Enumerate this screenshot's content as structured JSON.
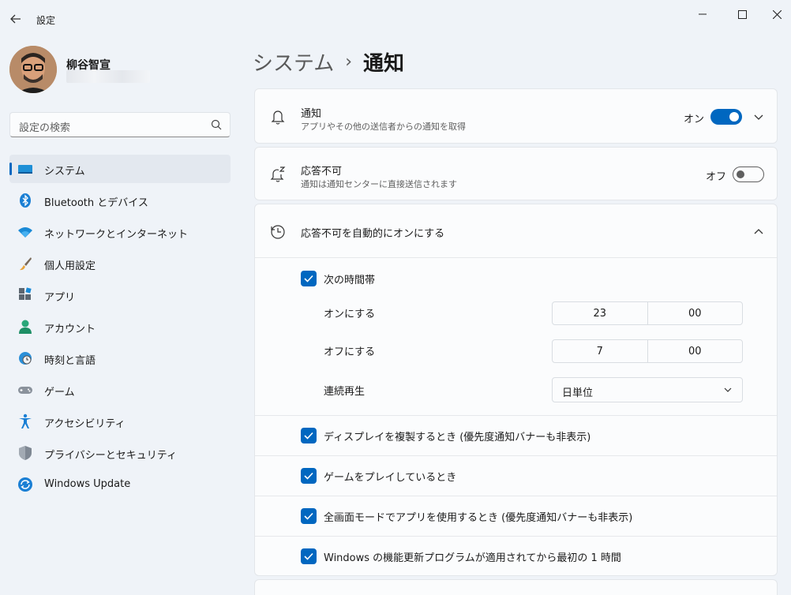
{
  "window": {
    "app_title": "設定",
    "back_icon": "arrow-left-icon",
    "controls": [
      "minimize-icon",
      "maximize-icon",
      "close-icon"
    ]
  },
  "user": {
    "name": "柳谷智宣"
  },
  "search": {
    "placeholder": "設定の検索",
    "icon": "search-icon"
  },
  "nav": {
    "items": [
      {
        "label": "システム",
        "icon": "display-icon",
        "active": true
      },
      {
        "label": "Bluetooth とデバイス",
        "icon": "bluetooth-icon"
      },
      {
        "label": "ネットワークとインターネット",
        "icon": "wifi-icon"
      },
      {
        "label": "個人用設定",
        "icon": "brush-icon"
      },
      {
        "label": "アプリ",
        "icon": "apps-icon"
      },
      {
        "label": "アカウント",
        "icon": "person-icon"
      },
      {
        "label": "時刻と言語",
        "icon": "globe-clock-icon"
      },
      {
        "label": "ゲーム",
        "icon": "gamepad-icon"
      },
      {
        "label": "アクセシビリティ",
        "icon": "accessibility-icon"
      },
      {
        "label": "プライバシーとセキュリティ",
        "icon": "shield-icon"
      },
      {
        "label": "Windows Update",
        "icon": "update-icon"
      }
    ]
  },
  "header": {
    "parent": "システム",
    "separator": "›",
    "current": "通知"
  },
  "notifications": {
    "title": "通知",
    "description": "アプリやその他の送信者からの通知を取得",
    "state": "オン",
    "enabled": true
  },
  "dnd": {
    "title": "応答不可",
    "description": "通知は通知センターに直接送信されます",
    "state": "オフ",
    "enabled": false
  },
  "auto_dnd": {
    "title": "応答不可を自動的にオンにする",
    "time_range": {
      "label": "次の時間帯",
      "checked": true,
      "on_label": "オンにする",
      "on_hour": "23",
      "on_minute": "00",
      "off_label": "オフにする",
      "off_hour": "7",
      "off_minute": "00",
      "repeat_label": "連続再生",
      "repeat_value": "日単位"
    },
    "options": [
      {
        "label": "ディスプレイを複製するとき (優先度通知バナーも非表示)",
        "checked": true
      },
      {
        "label": "ゲームをプレイしているとき",
        "checked": true
      },
      {
        "label": "全画面モードでアプリを使用するとき (優先度通知バナーも非表示)",
        "checked": true
      },
      {
        "label": "Windows の機能更新プログラムが適用されてから最初の 1 時間",
        "checked": true
      }
    ]
  },
  "colors": {
    "accent": "#0067c0",
    "background": "#eff3f8",
    "card": "#fbfcfd"
  }
}
